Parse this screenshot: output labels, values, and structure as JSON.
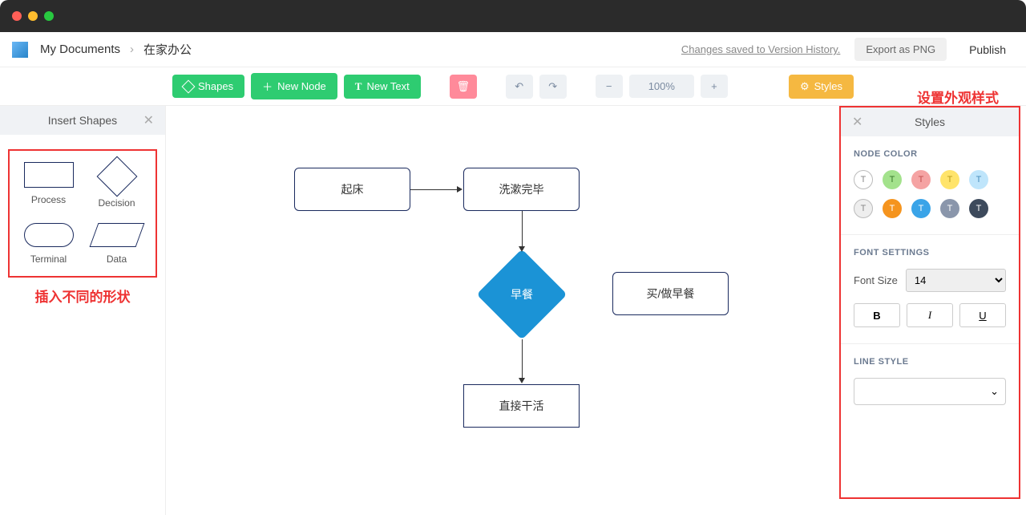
{
  "traffic": {
    "red": "#ff5f57",
    "yellow": "#ffbd2e",
    "green": "#28c940"
  },
  "breadcrumb": {
    "root": "My Documents",
    "current": "在家办公"
  },
  "header": {
    "version": "Changes saved to Version History.",
    "export": "Export as PNG",
    "publish": "Publish"
  },
  "toolbar": {
    "shapes": "Shapes",
    "newNode": "New Node",
    "newText": "New Text",
    "zoom": "100%",
    "styles": "Styles"
  },
  "leftPanel": {
    "title": "Insert Shapes",
    "shapes": [
      "Process",
      "Decision",
      "Terminal",
      "Data"
    ],
    "annotation": "插入不同的形状"
  },
  "rightPanel": {
    "annotation": "设置外观样式",
    "title": "Styles",
    "sections": {
      "nodeColor": "NODE COLOR",
      "fontSettings": "FONT SETTINGS",
      "fontSizeLabel": "Font Size",
      "fontSizeValue": "14",
      "lineStyle": "LINE STYLE"
    },
    "colors": [
      {
        "bg": "#fff",
        "fg": "#888",
        "outline": true
      },
      {
        "bg": "#a3e28c",
        "fg": "#3a7a2d"
      },
      {
        "bg": "#f5a3a3",
        "fg": "#c24d4d"
      },
      {
        "bg": "#ffe46b",
        "fg": "#b89b1e"
      },
      {
        "bg": "#bfe5fb",
        "fg": "#4a8fbc"
      },
      {
        "bg": "#eee",
        "fg": "#888",
        "outline": true
      },
      {
        "bg": "#f5941e",
        "fg": "#fff"
      },
      {
        "bg": "#3aa4e8",
        "fg": "#fff"
      },
      {
        "bg": "#8a96ab",
        "fg": "#fff"
      },
      {
        "bg": "#3d4a5c",
        "fg": "#fff"
      }
    ]
  },
  "nodes": {
    "n1": "起床",
    "n2": "洗漱完毕",
    "n3": "早餐",
    "n4": "买/做早餐",
    "n5": "直接干活"
  }
}
